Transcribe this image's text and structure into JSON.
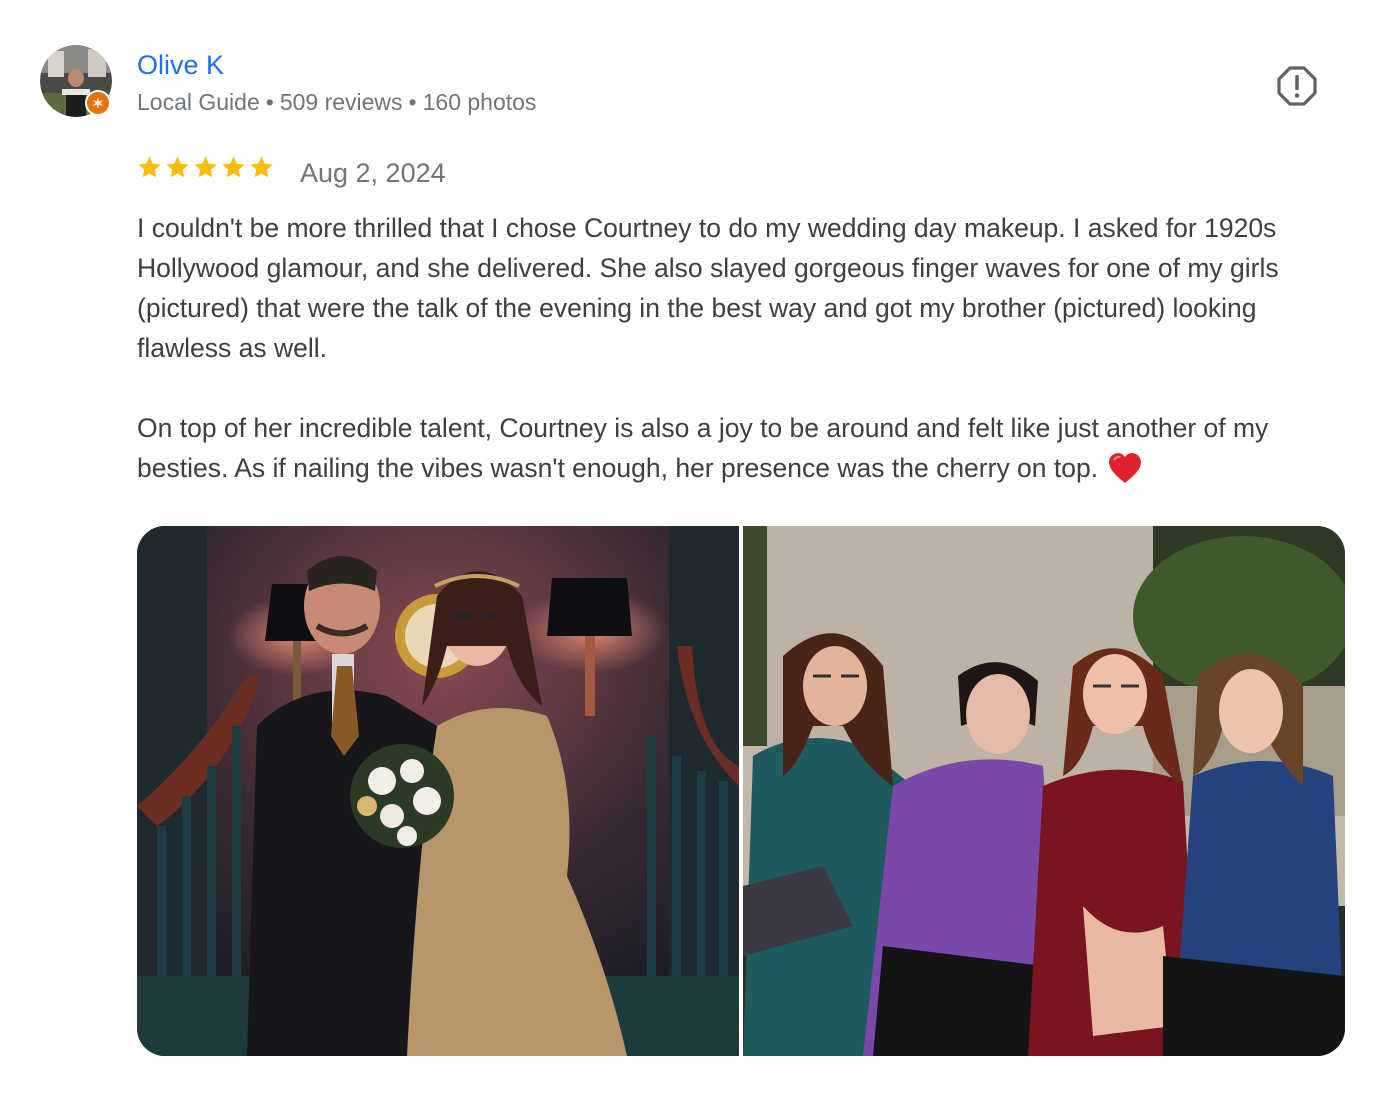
{
  "author": {
    "name": "Olive K",
    "badge": "Local Guide",
    "reviews": "509 reviews",
    "photos": "160 photos",
    "separator": "•",
    "badge_color": "#e8710a"
  },
  "review": {
    "rating": 5,
    "rating_max": 5,
    "star_color": "#fbbc04",
    "date": "Aug 2, 2024",
    "paragraphs": [
      "I couldn't be more thrilled that I chose Courtney to do my wedding day makeup. I asked for 1920s Hollywood glamour, and she delivered. She also slayed gorgeous finger waves for one of my girls (pictured) that were the talk of the evening in the best way and got my brother (pictured) looking flawless as well.",
      "On top of her incredible talent, Courtney is also a joy to be around and felt like just another of my besties. As if nailing the vibes wasn't enough, her presence was the cherry on top."
    ],
    "emoji": "red-heart-icon"
  },
  "photos": [
    {
      "icon": "wedding-couple-photo"
    },
    {
      "icon": "bridal-party-photo"
    }
  ],
  "icons": {
    "report": "report-flag-icon",
    "avatar": "user-avatar",
    "badge": "local-guide-badge-icon",
    "star": "star-icon"
  },
  "colors": {
    "name_link": "#1a73e8",
    "meta_text": "#70757a",
    "body_text": "#3c4043"
  }
}
